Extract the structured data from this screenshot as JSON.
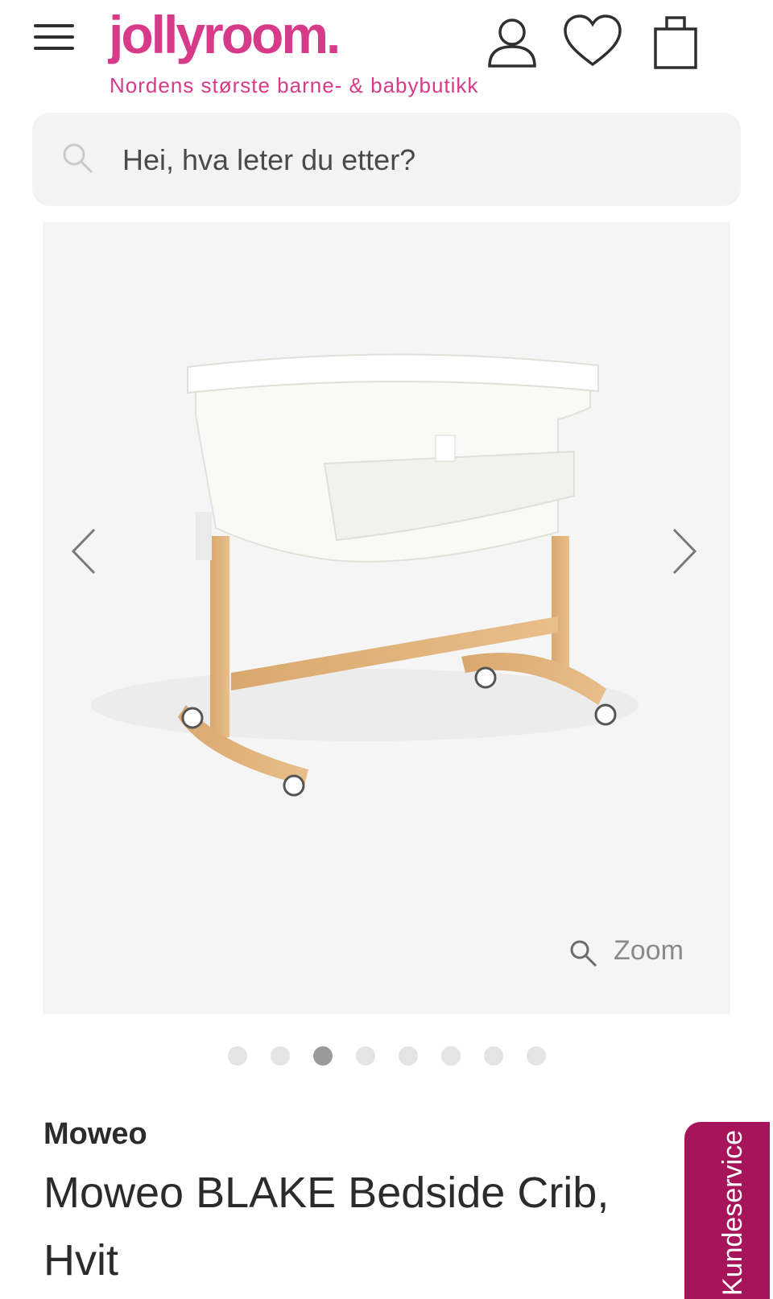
{
  "header": {
    "logo": "jollyroom.",
    "tagline": "Nordens største barne- & babybutikk",
    "brand_color": "#d83a8a",
    "icons": [
      "menu-icon",
      "user-icon",
      "heart-icon",
      "shopping-bag-icon"
    ]
  },
  "search": {
    "placeholder": "Hei, hva leter du etter?",
    "value": ""
  },
  "gallery": {
    "zoom_label": "Zoom",
    "dot_count": 8,
    "active_index": 3
  },
  "product": {
    "brand": "Moweo",
    "title": "Moweo BLAKE Bedside Crib, Hvit"
  },
  "customer_service": {
    "label": "Kundeservice",
    "color": "#a6145a"
  }
}
